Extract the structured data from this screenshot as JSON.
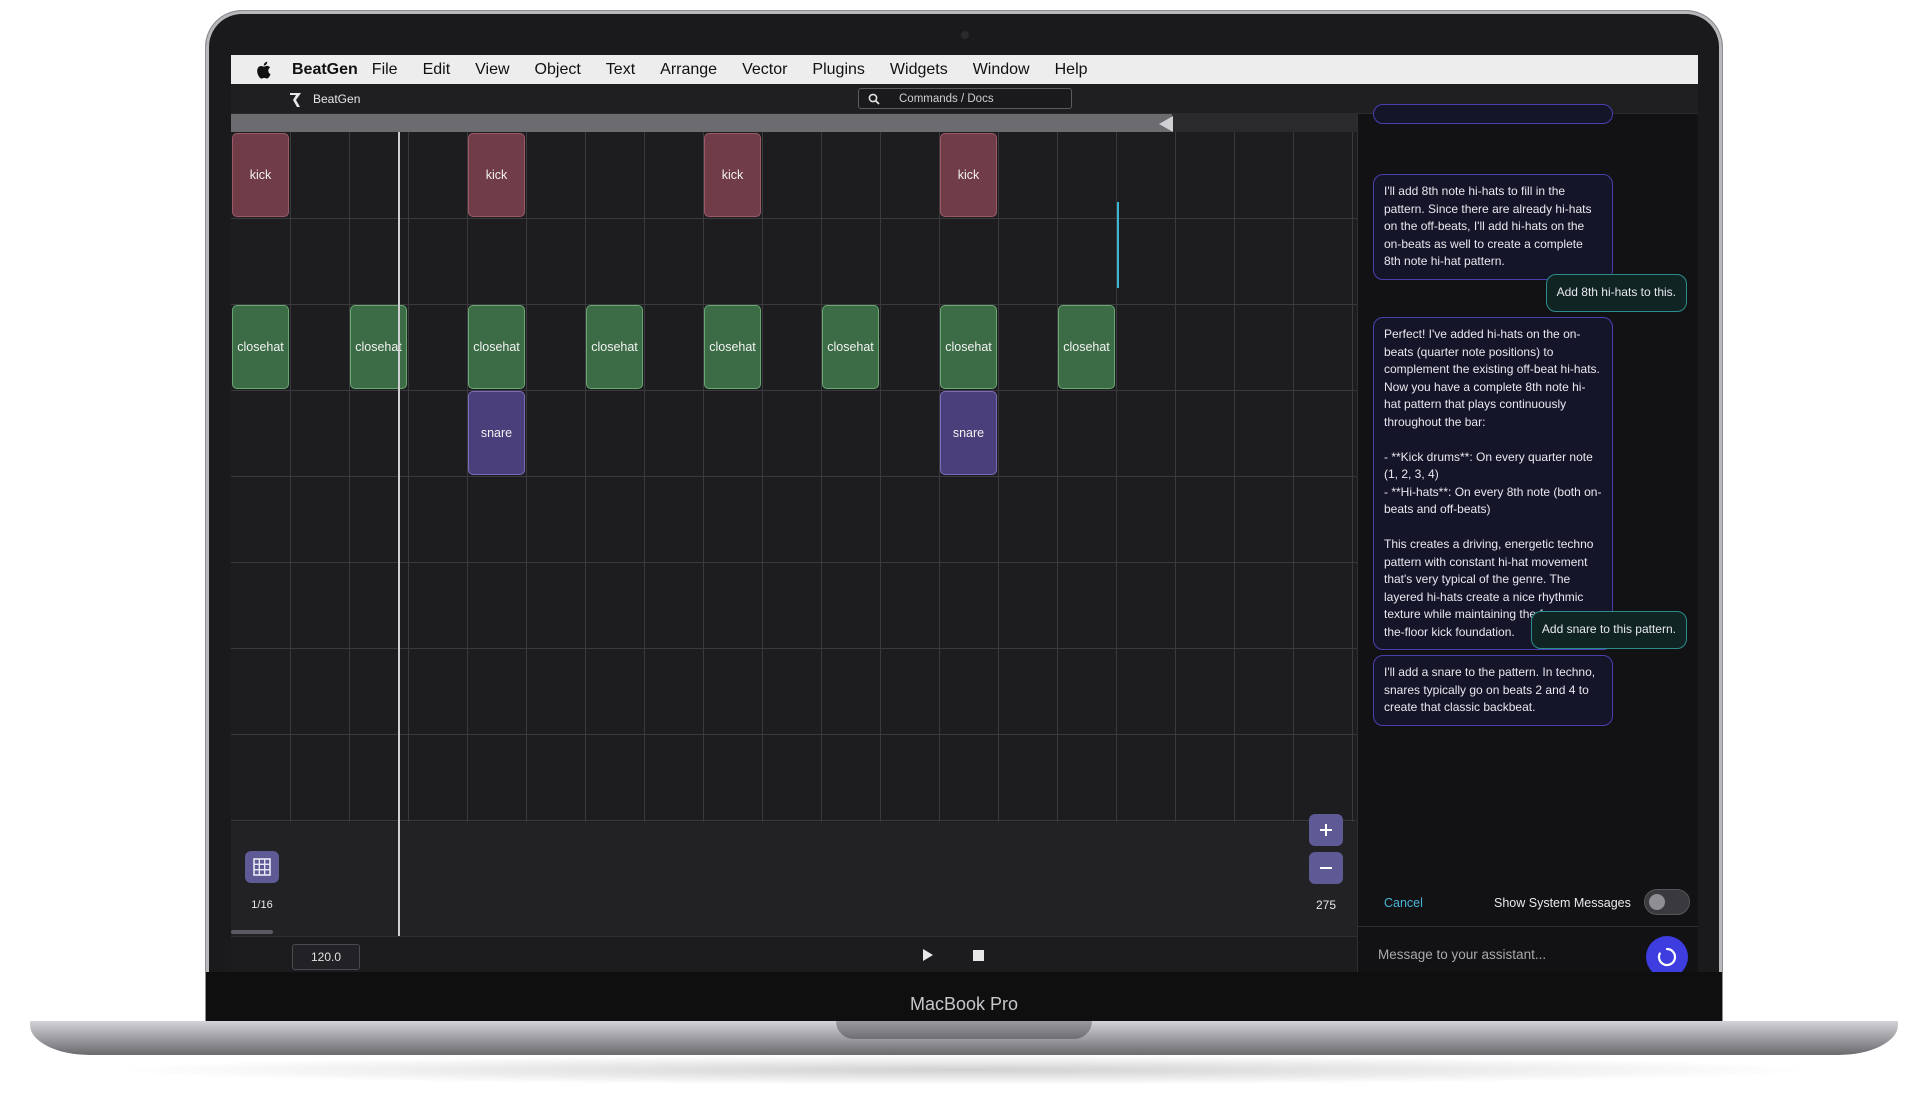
{
  "device": {
    "label": "MacBook Pro"
  },
  "menubar": {
    "app_name": "BeatGen",
    "items": [
      "File",
      "Edit",
      "View",
      "Object",
      "Text",
      "Arrange",
      "Vector",
      "Plugins",
      "Widgets",
      "Window",
      "Help"
    ]
  },
  "titlebar": {
    "app_title": "BeatGen",
    "search_placeholder": "Commands / Docs"
  },
  "sequencer": {
    "notes": [
      {
        "name": "kick",
        "row": 0,
        "step": 0
      },
      {
        "name": "kick",
        "row": 0,
        "step": 4
      },
      {
        "name": "kick",
        "row": 0,
        "step": 8
      },
      {
        "name": "kick",
        "row": 0,
        "step": 12
      },
      {
        "name": "closehat",
        "row": 2,
        "step": 0
      },
      {
        "name": "closehat",
        "row": 2,
        "step": 2
      },
      {
        "name": "closehat",
        "row": 2,
        "step": 4
      },
      {
        "name": "closehat",
        "row": 2,
        "step": 6
      },
      {
        "name": "closehat",
        "row": 2,
        "step": 8
      },
      {
        "name": "closehat",
        "row": 2,
        "step": 10
      },
      {
        "name": "closehat",
        "row": 2,
        "step": 12
      },
      {
        "name": "closehat",
        "row": 2,
        "step": 14
      },
      {
        "name": "snare",
        "row": 3,
        "step": 4
      },
      {
        "name": "snare",
        "row": 3,
        "step": 12
      }
    ],
    "quantize": "1/16",
    "zoom": "275",
    "tempo": "120.0"
  },
  "chat": {
    "messages": [
      {
        "role": "assistant",
        "text": "I'll add 8th note hi-hats to fill in the pattern. Since there are already hi-hats on the off-beats, I'll add hi-hats on the on-beats as well to create a complete 8th note hi-hat pattern."
      },
      {
        "role": "user",
        "text": "Add 8th hi-hats to this."
      },
      {
        "role": "assistant",
        "text": "Perfect! I've added hi-hats on the on-beats (quarter note positions) to complement the existing off-beat hi-hats. Now you have a complete 8th note hi-hat pattern that plays continuously throughout the bar:\n\n- **Kick drums**: On every quarter note (1, 2, 3, 4)\n- **Hi-hats**: On every 8th note (both on-beats and off-beats)\n\nThis creates a driving, energetic techno pattern with constant hi-hat movement that's very typical of the genre. The layered hi-hats create a nice rhythmic texture while maintaining the four-on-the-floor kick foundation."
      },
      {
        "role": "user",
        "text": "Add snare to this pattern."
      },
      {
        "role": "assistant",
        "text": "I'll add a snare to the pattern. In techno, snares typically go on beats 2 and 4 to create that classic backbeat."
      }
    ],
    "cancel_label": "Cancel",
    "system_messages_label": "Show System Messages",
    "system_messages_on": false,
    "input_placeholder": "Message to your assistant..."
  },
  "colors": {
    "kick": "#703c48",
    "closehat": "#3c6c46",
    "snare": "#4a3f7a",
    "accent": "#3d3de0",
    "link": "#4bb3d8"
  }
}
